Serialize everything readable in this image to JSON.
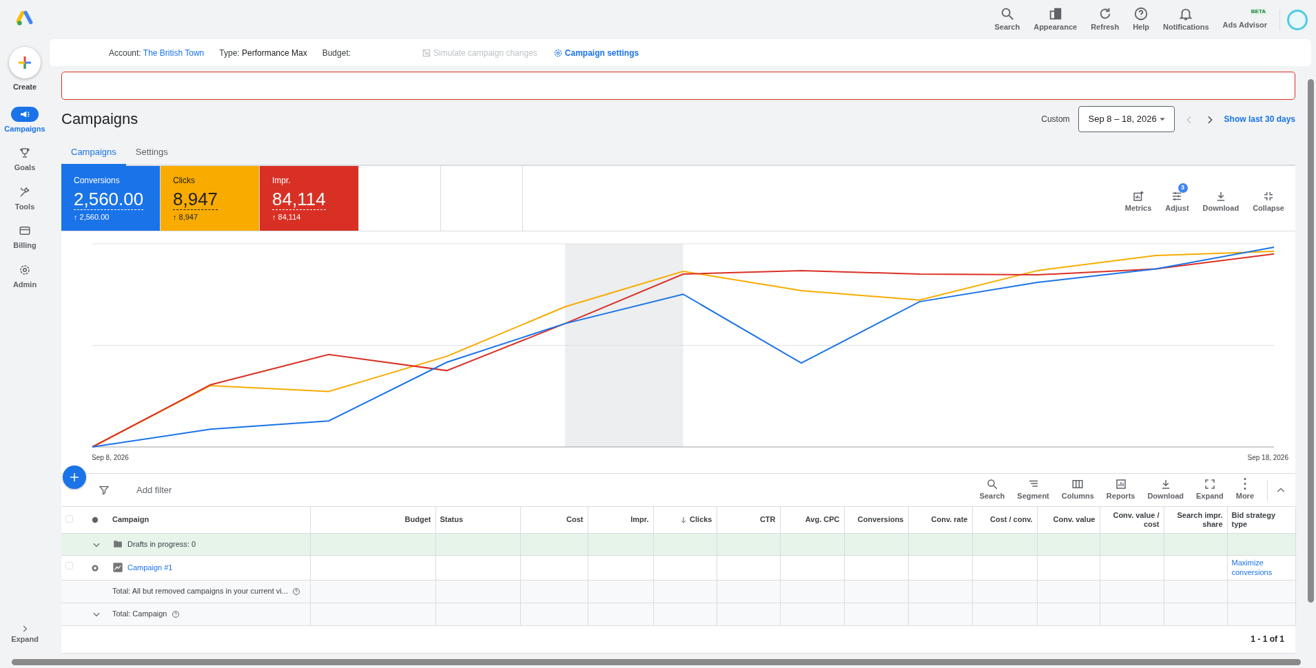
{
  "sidebar": {
    "create_label": "Create",
    "items": [
      {
        "label": "Campaigns",
        "selected": true
      },
      {
        "label": "Goals",
        "selected": false
      },
      {
        "label": "Tools",
        "selected": false
      },
      {
        "label": "Billing",
        "selected": false
      },
      {
        "label": "Admin",
        "selected": false
      }
    ],
    "expand_label": "Expand"
  },
  "topbar": {
    "actions": [
      {
        "label": "Search"
      },
      {
        "label": "Appearance"
      },
      {
        "label": "Refresh"
      },
      {
        "label": "Help"
      },
      {
        "label": "Notifications"
      },
      {
        "label": "Ads Advisor",
        "badge": "BETA"
      }
    ]
  },
  "account_bar": {
    "account_label": "Account:",
    "account": "The British Town",
    "type_label": "Type:",
    "type": "Performance Max",
    "budget_label": "Budget:",
    "simulate": {
      "label": "Simulate campaign changes",
      "disabled": true
    },
    "settings": "Campaign settings"
  },
  "page": {
    "title": "Campaigns",
    "range_label": "Custom",
    "date_range": "Sep 8 – 18, 2026",
    "show_last": "Show last 30 days"
  },
  "tabs": [
    {
      "label": "Campaigns",
      "selected": true
    },
    {
      "label": "Settings",
      "selected": false
    }
  ],
  "metrics": [
    {
      "name": "Conversions",
      "value": "2,560.00",
      "change": "↑ 2,560.00",
      "color": "#1a73e8"
    },
    {
      "name": "Clicks",
      "value": "8,947",
      "change": "↑ 8,947",
      "color": "#f9ab00"
    },
    {
      "name": "Impr.",
      "value": "84,114",
      "change": "↑ 84,114",
      "color": "#d93025"
    }
  ],
  "chart_tools": [
    {
      "label": "Metrics"
    },
    {
      "label": "Adjust",
      "badge": "3"
    },
    {
      "label": "Download"
    },
    {
      "label": "Collapse"
    }
  ],
  "chart": {
    "start_label": "Sep 8, 2026",
    "end_label": "Sep 18, 2026"
  },
  "filter": {
    "label": "Add filter"
  },
  "table_tools": [
    {
      "label": "Search"
    },
    {
      "label": "Segment"
    },
    {
      "label": "Columns"
    },
    {
      "label": "Reports"
    },
    {
      "label": "Download"
    },
    {
      "label": "Expand"
    },
    {
      "label": "More"
    }
  ],
  "table": {
    "select_all_checked": false,
    "columns": [
      {
        "label": "Campaign",
        "sorted": false
      },
      {
        "label": "Budget",
        "sorted": false
      },
      {
        "label": "Status",
        "sorted": false
      },
      {
        "label": "Cost",
        "sorted": false
      },
      {
        "label": "Impr.",
        "sorted": false
      },
      {
        "label": "Clicks",
        "sorted": true
      },
      {
        "label": "CTR",
        "sorted": false
      },
      {
        "label": "Avg. CPC",
        "sorted": false
      },
      {
        "label": "Conversions",
        "sorted": false
      },
      {
        "label": "Conv. rate",
        "sorted": false
      },
      {
        "label": "Cost / conv.",
        "sorted": false
      },
      {
        "label": "Conv. value",
        "sorted": false
      },
      {
        "label": "Conv. value / cost",
        "sorted": false
      },
      {
        "label": "Search impr. share",
        "sorted": false
      },
      {
        "label": "Bid strategy type",
        "sorted": false
      }
    ],
    "rows": [
      {
        "kind": "drafts",
        "label": "Drafts in progress: 0"
      },
      {
        "kind": "campaign",
        "label": "Campaign #1",
        "checked": false,
        "bid_strategy": "Maximize conversions"
      },
      {
        "kind": "total",
        "label": "Total: All but removed campaigns in your current vi..."
      },
      {
        "kind": "total_expand",
        "label": "Total: Campaign"
      }
    ],
    "pagination": "1 - 1 of 1"
  }
}
